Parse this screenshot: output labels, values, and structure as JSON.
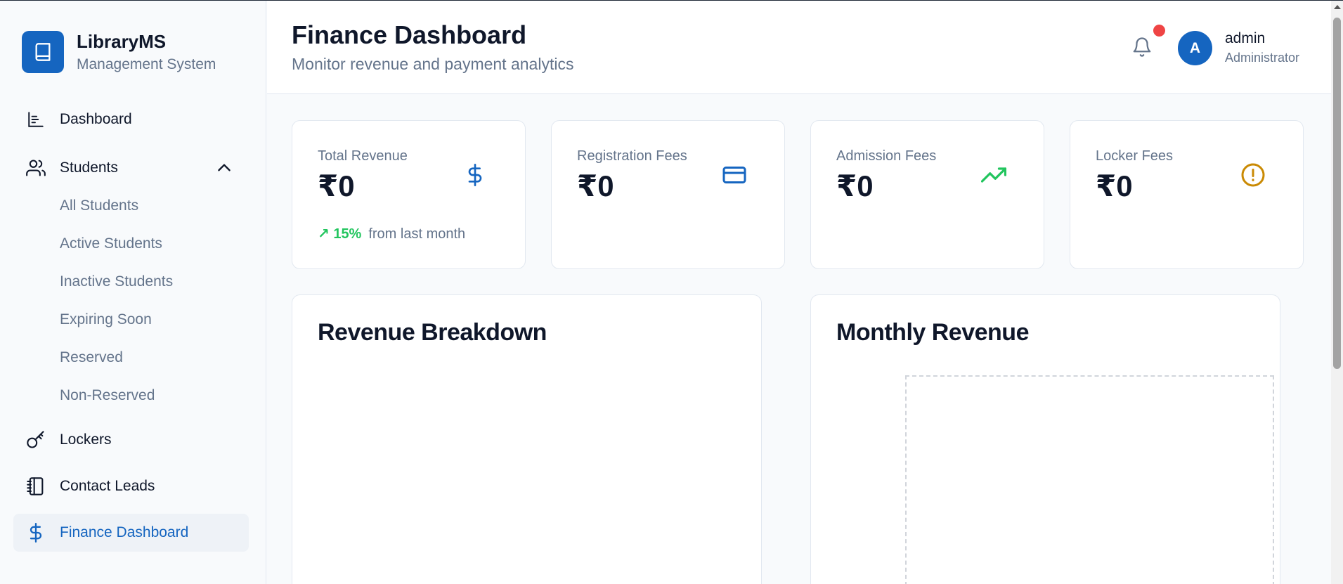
{
  "brand": {
    "name": "LibraryMS",
    "subtitle": "Management System",
    "logo_icon": "book-icon"
  },
  "sidebar": {
    "items": [
      {
        "label": "Dashboard",
        "icon": "bar-chart-icon"
      },
      {
        "label": "Students",
        "icon": "users-icon",
        "expanded": true
      },
      {
        "label": "Lockers",
        "icon": "key-icon"
      },
      {
        "label": "Contact Leads",
        "icon": "notebook-icon"
      },
      {
        "label": "Finance Dashboard",
        "icon": "dollar-icon",
        "active": true
      }
    ],
    "students_sub": [
      "All Students",
      "Active Students",
      "Inactive Students",
      "Expiring Soon",
      "Reserved",
      "Non-Reserved"
    ]
  },
  "header": {
    "title": "Finance Dashboard",
    "subtitle": "Monitor revenue and payment analytics",
    "user": {
      "initial": "A",
      "name": "admin",
      "role": "Administrator"
    }
  },
  "stats": [
    {
      "label": "Total Revenue",
      "value": "₹0",
      "icon": "dollar-icon",
      "color": "#1565c0",
      "trend": "↗ 15%",
      "trend_text": "from last month"
    },
    {
      "label": "Registration Fees",
      "value": "₹0",
      "icon": "credit-card-icon",
      "color": "#1565c0"
    },
    {
      "label": "Admission Fees",
      "value": "₹0",
      "icon": "trending-up-icon",
      "color": "#22c55e"
    },
    {
      "label": "Locker Fees",
      "value": "₹0",
      "icon": "alert-circle-icon",
      "color": "#ca8a04"
    }
  ],
  "panels": {
    "breakdown_title": "Revenue Breakdown",
    "monthly_title": "Monthly Revenue"
  },
  "colors": {
    "accent": "#1565c0",
    "notification": "#ef4444"
  }
}
